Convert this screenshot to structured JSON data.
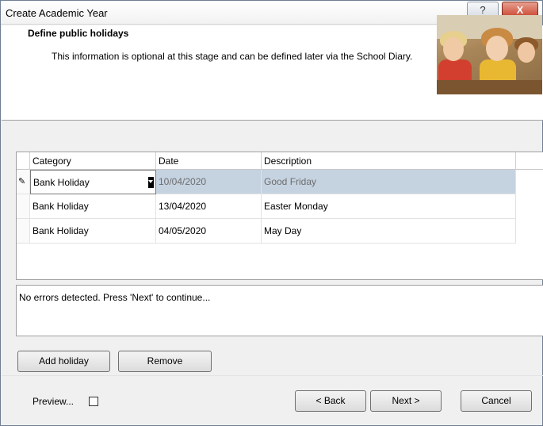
{
  "window": {
    "title": "Create Academic Year",
    "help_glyph": "?",
    "close_glyph": "X"
  },
  "header": {
    "title": "Define public holidays",
    "description": "This information is optional at this stage and can be defined later via the School Diary."
  },
  "grid": {
    "columns": [
      "Category",
      "Date",
      "Description"
    ],
    "rows": [
      {
        "category": "Bank Holiday",
        "date": "10/04/2020",
        "description": "Good Friday",
        "selected": true,
        "editing": true
      },
      {
        "category": "Bank Holiday",
        "date": "13/04/2020",
        "description": "Easter Monday",
        "selected": false
      },
      {
        "category": "Bank Holiday",
        "date": "04/05/2020",
        "description": "May Day",
        "selected": false
      }
    ],
    "edit_glyph": "✎"
  },
  "status": {
    "message": "No errors detected. Press 'Next' to continue..."
  },
  "actions": {
    "add_holiday": "Add holiday",
    "remove": "Remove"
  },
  "footer": {
    "preview_label": "Preview...",
    "preview_checked": false,
    "back": "< Back",
    "next": "Next >",
    "cancel": "Cancel"
  },
  "colors": {
    "selected_row": "#c5d2e0",
    "close_button": "#c9442e"
  }
}
